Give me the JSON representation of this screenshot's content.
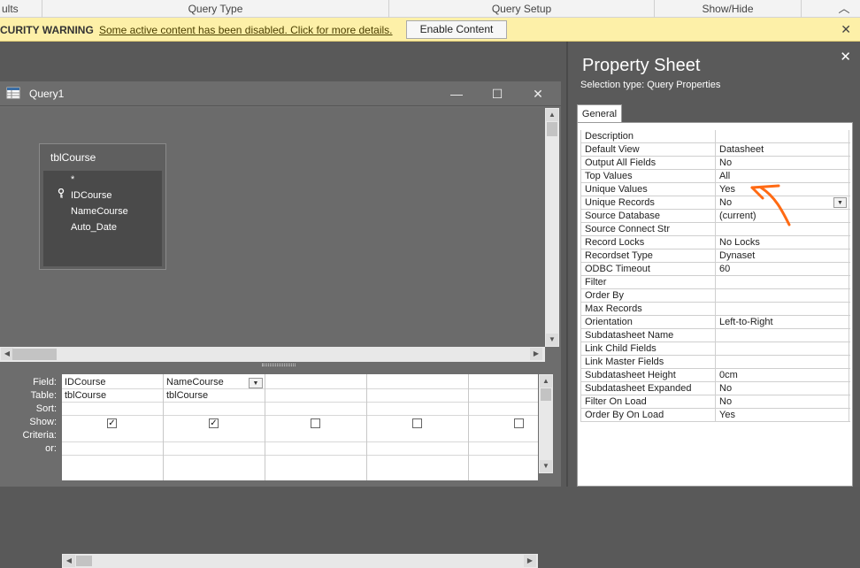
{
  "ribbon": {
    "groups": [
      "ults",
      "Query Type",
      "Query Setup",
      "Show/Hide"
    ]
  },
  "security": {
    "title": "CURITY WARNING",
    "message": "Some active content has been disabled. Click for more details.",
    "enable_label": "Enable Content",
    "close_glyph": "✕"
  },
  "query_window": {
    "title": "Query1",
    "minimize_glyph": "—",
    "maximize_glyph": "☐",
    "close_glyph": "✕",
    "table": {
      "title": "tblCourse",
      "fields": [
        "*",
        "IDCourse",
        "NameCourse",
        "Auto_Date"
      ],
      "key_glyph": "🔑"
    },
    "grid": {
      "row_labels": [
        "Field:",
        "Table:",
        "Sort:",
        "Show:",
        "Criteria:",
        "or:"
      ],
      "columns": [
        {
          "field": "IDCourse",
          "table": "tblCourse",
          "show": true
        },
        {
          "field": "NameCourse",
          "table": "tblCourse",
          "show": true
        },
        {
          "field": "",
          "table": "",
          "show": false
        },
        {
          "field": "",
          "table": "",
          "show": false
        },
        {
          "field": "",
          "table": "",
          "show": false
        }
      ]
    }
  },
  "property_sheet": {
    "title": "Property Sheet",
    "close_glyph": "✕",
    "selection_type": "Selection type:  Query Properties",
    "tab": "General",
    "rows": [
      {
        "name": "Description",
        "value": ""
      },
      {
        "name": "Default View",
        "value": "Datasheet"
      },
      {
        "name": "Output All Fields",
        "value": "No"
      },
      {
        "name": "Top Values",
        "value": "All"
      },
      {
        "name": "Unique Values",
        "value": "Yes"
      },
      {
        "name": "Unique Records",
        "value": "No"
      },
      {
        "name": "Source Database",
        "value": "(current)"
      },
      {
        "name": "Source Connect Str",
        "value": ""
      },
      {
        "name": "Record Locks",
        "value": "No Locks"
      },
      {
        "name": "Recordset Type",
        "value": "Dynaset"
      },
      {
        "name": "ODBC Timeout",
        "value": "60"
      },
      {
        "name": "Filter",
        "value": ""
      },
      {
        "name": "Order By",
        "value": ""
      },
      {
        "name": "Max Records",
        "value": ""
      },
      {
        "name": "Orientation",
        "value": "Left-to-Right"
      },
      {
        "name": "Subdatasheet Name",
        "value": ""
      },
      {
        "name": "Link Child Fields",
        "value": ""
      },
      {
        "name": "Link Master Fields",
        "value": ""
      },
      {
        "name": "Subdatasheet Height",
        "value": "0cm"
      },
      {
        "name": "Subdatasheet Expanded",
        "value": "No"
      },
      {
        "name": "Filter On Load",
        "value": "No"
      },
      {
        "name": "Order By On Load",
        "value": "Yes"
      }
    ]
  },
  "colors": {
    "warning_bar": "#fdf0a8",
    "annotation": "#ff6a13"
  }
}
